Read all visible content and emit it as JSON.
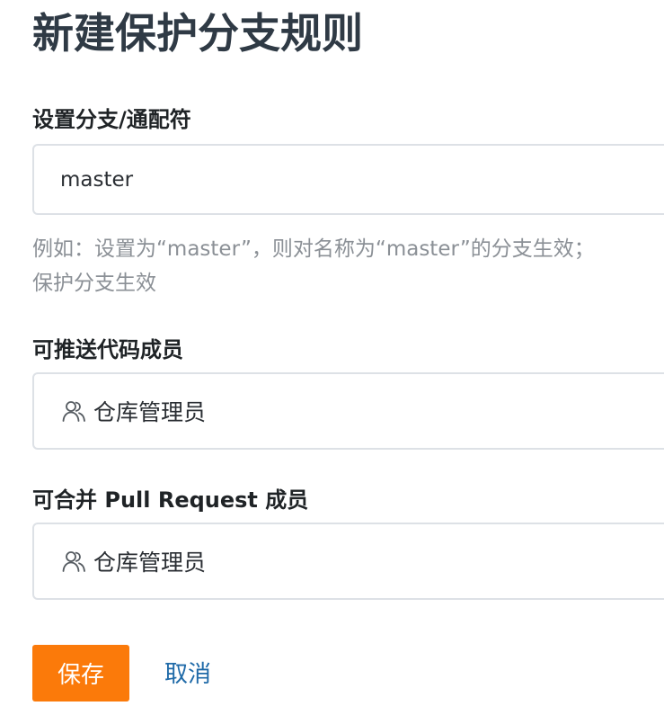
{
  "page": {
    "title": "新建保护分支规则"
  },
  "branch": {
    "label": "设置分支/通配符",
    "value": "master",
    "hint_line1": "例如：设置为“master”，则对名称为“master”的分支生效；",
    "hint_line2": "保护分支生效"
  },
  "push_members": {
    "label": "可推送代码成员",
    "tag_icon": "users-icon",
    "tag_label": "仓库管理员"
  },
  "merge_members": {
    "label": "可合并 Pull Request 成员",
    "tag_icon": "users-icon",
    "tag_label": "仓库管理员"
  },
  "actions": {
    "save_label": "保存",
    "cancel_label": "取消"
  },
  "colors": {
    "title": "#2f3a45",
    "primary_button": "#fb7a0a",
    "link": "#1f6aa8",
    "hint": "#8b9096",
    "border": "#dde1e6"
  }
}
